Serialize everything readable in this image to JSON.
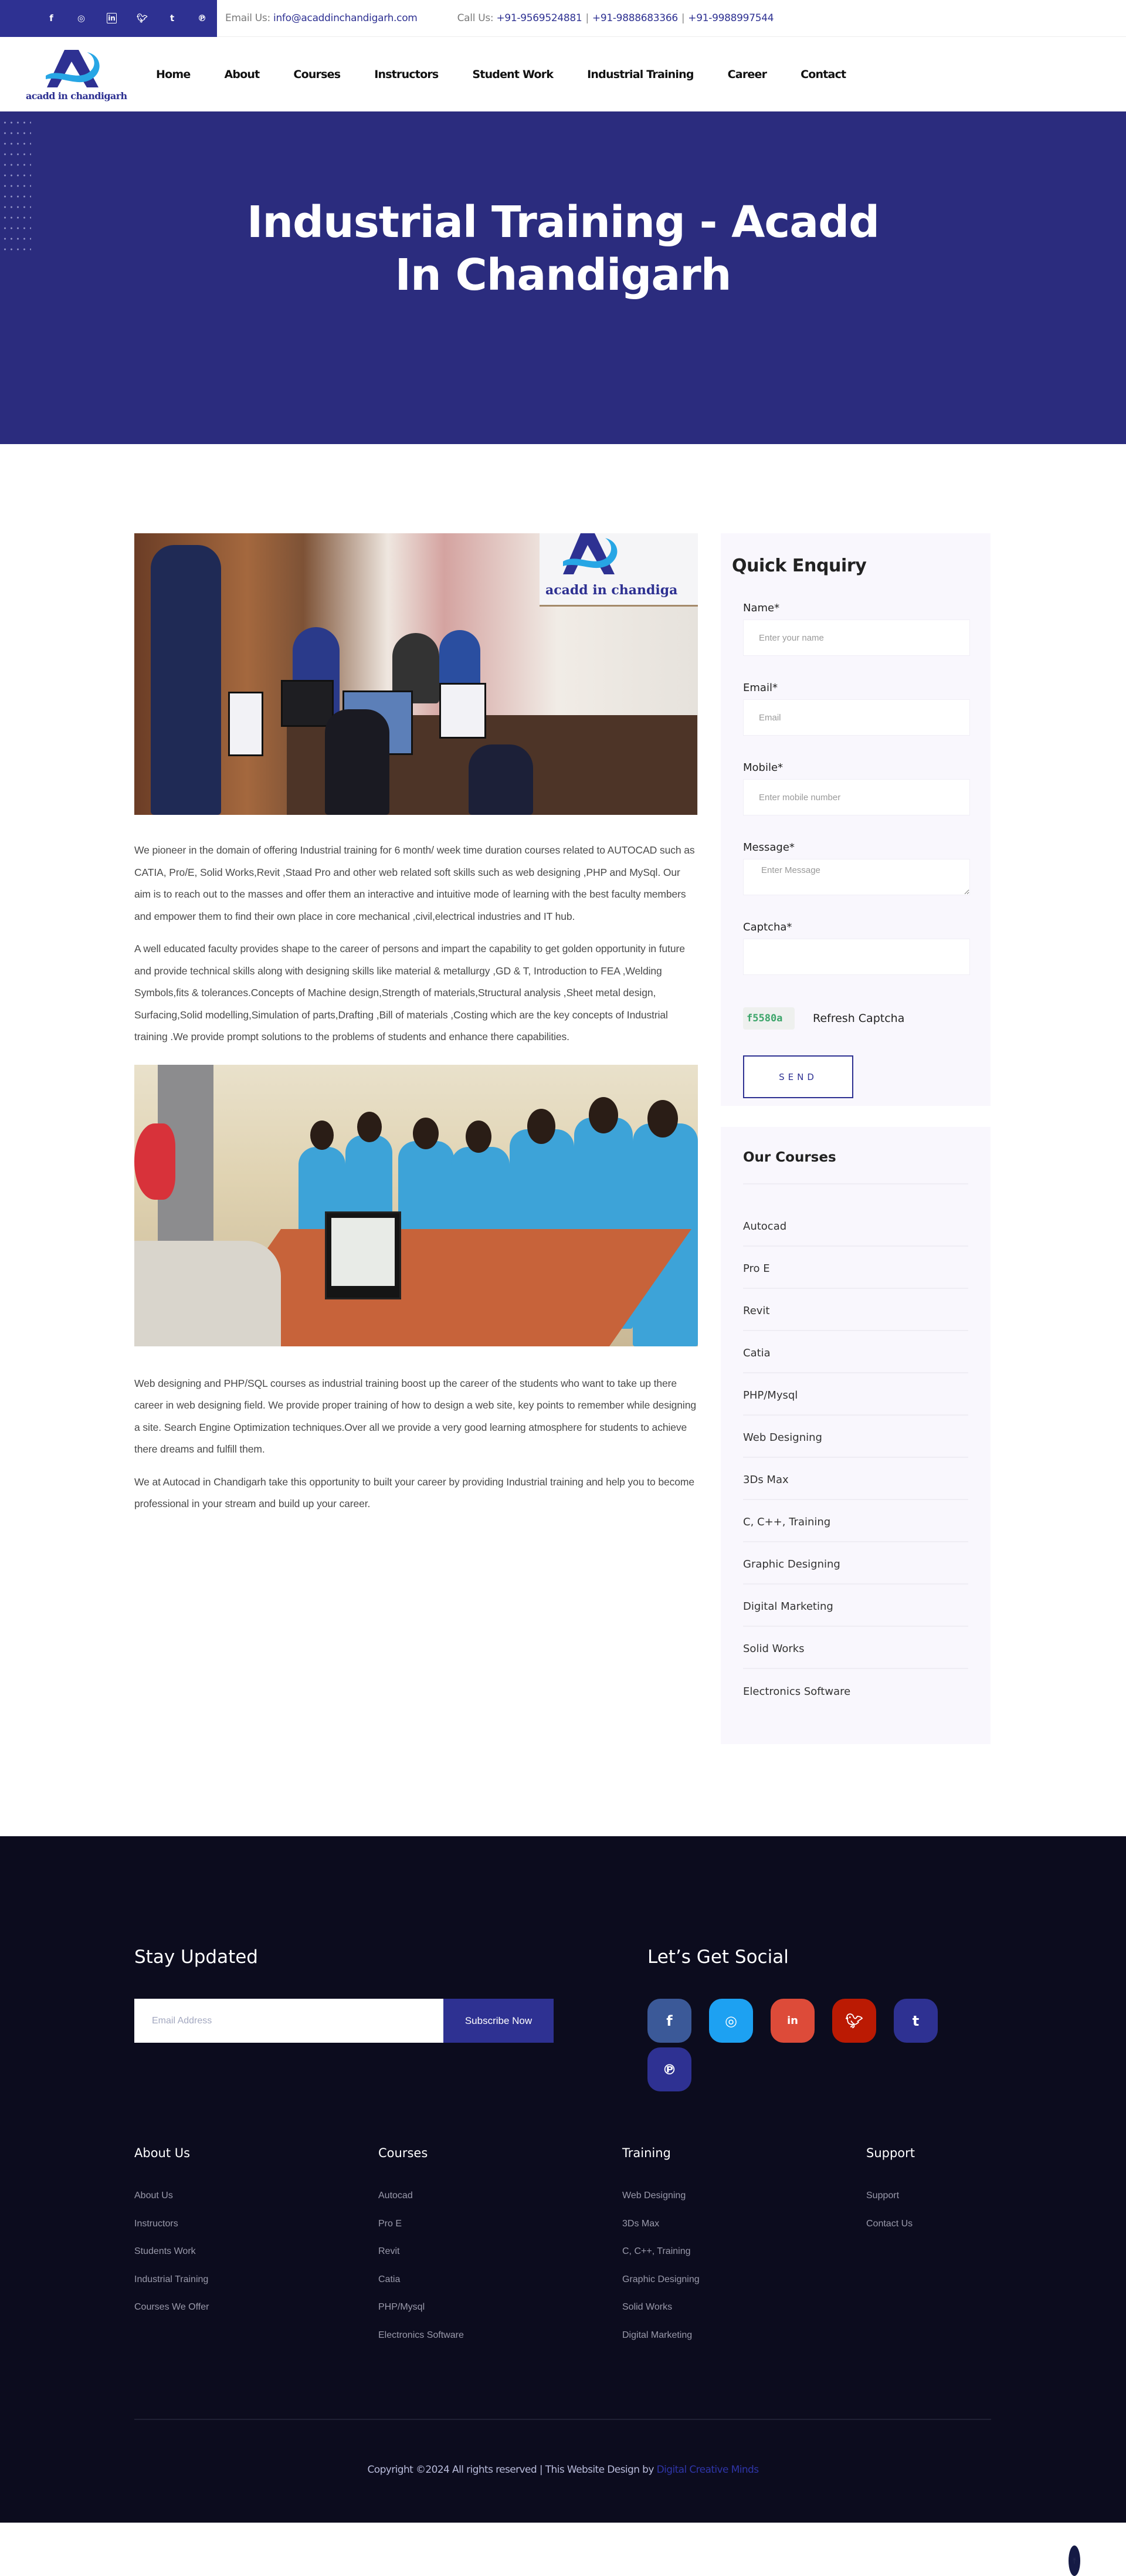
{
  "topbar": {
    "social_icons": [
      {
        "name": "facebook",
        "glyph": "f"
      },
      {
        "name": "instagram",
        "glyph": "◎"
      },
      {
        "name": "linkedin",
        "glyph": "in"
      },
      {
        "name": "twitter",
        "glyph": "🐦︎"
      },
      {
        "name": "tumblr",
        "glyph": "t"
      },
      {
        "name": "pinterest",
        "glyph": "℗"
      }
    ],
    "email_label": "Email Us:",
    "email": "info@acaddinchandigarh.com",
    "call_label": "Call Us:",
    "phones": [
      "+91-9569524881",
      "+91-9888683366",
      "+91-9988997544"
    ]
  },
  "header": {
    "logo_text": "acadd in chandigarh",
    "nav": [
      "Home",
      "About",
      "Courses",
      "Instructors",
      "Student Work",
      "Industrial Training",
      "Career",
      "Contact"
    ]
  },
  "hero": {
    "title": "Industrial Training - Acadd In Chandigarh"
  },
  "content": {
    "photo1_brand": "acadd in chandiga",
    "paragraphs": [
      "We pioneer in the domain of offering Industrial training for 6 month/ week time duration courses related to AUTOCAD such as CATIA, Pro/E, Solid Works,Revit ,Staad Pro and other web related soft skills such as web designing ,PHP and MySql. Our aim is to reach out to the masses and offer them an interactive and intuitive mode of learning with the best faculty members and empower them to find their own place in core mechanical ,civil,electrical industries and IT hub.",
      "A well educated faculty provides shape to the career of persons and impart the capability to get golden opportunity in future and provide technical skills along with designing skills like material & metallurgy ,GD & T, Introduction to FEA ,Welding Symbols,fits & tolerances.Concepts of Machine design,Strength of materials,Structural analysis ,Sheet metal design, Surfacing,Solid modelling,Simulation of parts,Drafting ,Bill of materials ,Costing which are the key concepts of Industrial training .We provide prompt solutions to the problems of students and enhance there capabilities.",
      "Web designing and PHP/SQL courses as industrial training boost up the career of the students who want to take up there career in web designing field. We provide proper training of how to design a web site, key points to remember while designing a site. Search Engine Optimization techniques.Over all we provide a very good learning atmosphere for students to achieve there dreams and fulfill them.",
      "We at Autocad in Chandigarh take this opportunity to built your career by providing Industrial training and help you to become professional in your stream and build up your career."
    ]
  },
  "enquiry": {
    "title": "Quick Enquiry",
    "name_label": "Name*",
    "name_placeholder": "Enter your name",
    "email_label": "Email*",
    "email_placeholder": "Email",
    "mobile_label": "Mobile*",
    "mobile_placeholder": "Enter mobile number",
    "message_label": "Message*",
    "message_placeholder": "Enter Message",
    "captcha_label": "Captcha*",
    "captcha_value": "",
    "captcha_code": "f5580a",
    "refresh_label": "Refresh Captcha",
    "send_label": "SEND"
  },
  "courses": {
    "title": "Our Courses",
    "items": [
      "Autocad",
      "Pro E",
      "Revit",
      "Catia",
      "PHP/Mysql",
      "Web Designing",
      "3Ds Max",
      "C, C++, Training",
      "Graphic Designing",
      "Digital Marketing",
      "Solid Works",
      "Electronics Software"
    ]
  },
  "footer": {
    "stay_title": "Stay Updated",
    "email_placeholder": "Email Address",
    "subscribe_label": "Subscribe Now",
    "social_title": "Let’s Get Social",
    "social": [
      {
        "name": "facebook",
        "glyph": "f",
        "color": "#3b5998"
      },
      {
        "name": "instagram",
        "glyph": "◎",
        "color": "#1da1f2"
      },
      {
        "name": "linkedin",
        "glyph": "in",
        "color": "#dd4b39"
      },
      {
        "name": "twitter",
        "glyph": "🐦︎",
        "color": "#bb1a03"
      },
      {
        "name": "tumblr",
        "glyph": "t",
        "color": "#2e3192"
      },
      {
        "name": "pinterest",
        "glyph": "℗",
        "color": "#2e3192"
      }
    ],
    "columns": [
      {
        "title": "About Us",
        "links": [
          "About Us",
          "Instructors",
          "Students Work",
          "Industrial Training",
          "Courses We Offer"
        ]
      },
      {
        "title": "Courses",
        "links": [
          "Autocad",
          "Pro E",
          "Revit",
          "Catia",
          "PHP/Mysql",
          "Electronics Software"
        ]
      },
      {
        "title": "Training",
        "links": [
          "Web Designing",
          "3Ds Max",
          "C, C++, Training",
          "Graphic Designing",
          "Solid Works",
          "Digital Marketing"
        ]
      },
      {
        "title": "Support",
        "links": [
          "Support",
          "Contact Us"
        ]
      }
    ],
    "copyright": "Copyright ©2024 All rights reserved | This Website Design by ",
    "designer": "Digital Creative Minds",
    "to_top_glyph": "⤒"
  },
  "colors": {
    "brand": "#2e3192",
    "hero_bg": "#2b2c7e",
    "footer_bg": "#0c0c1e",
    "sidebar_bg": "#f9f7fd",
    "captcha_text": "#3ca56a"
  }
}
